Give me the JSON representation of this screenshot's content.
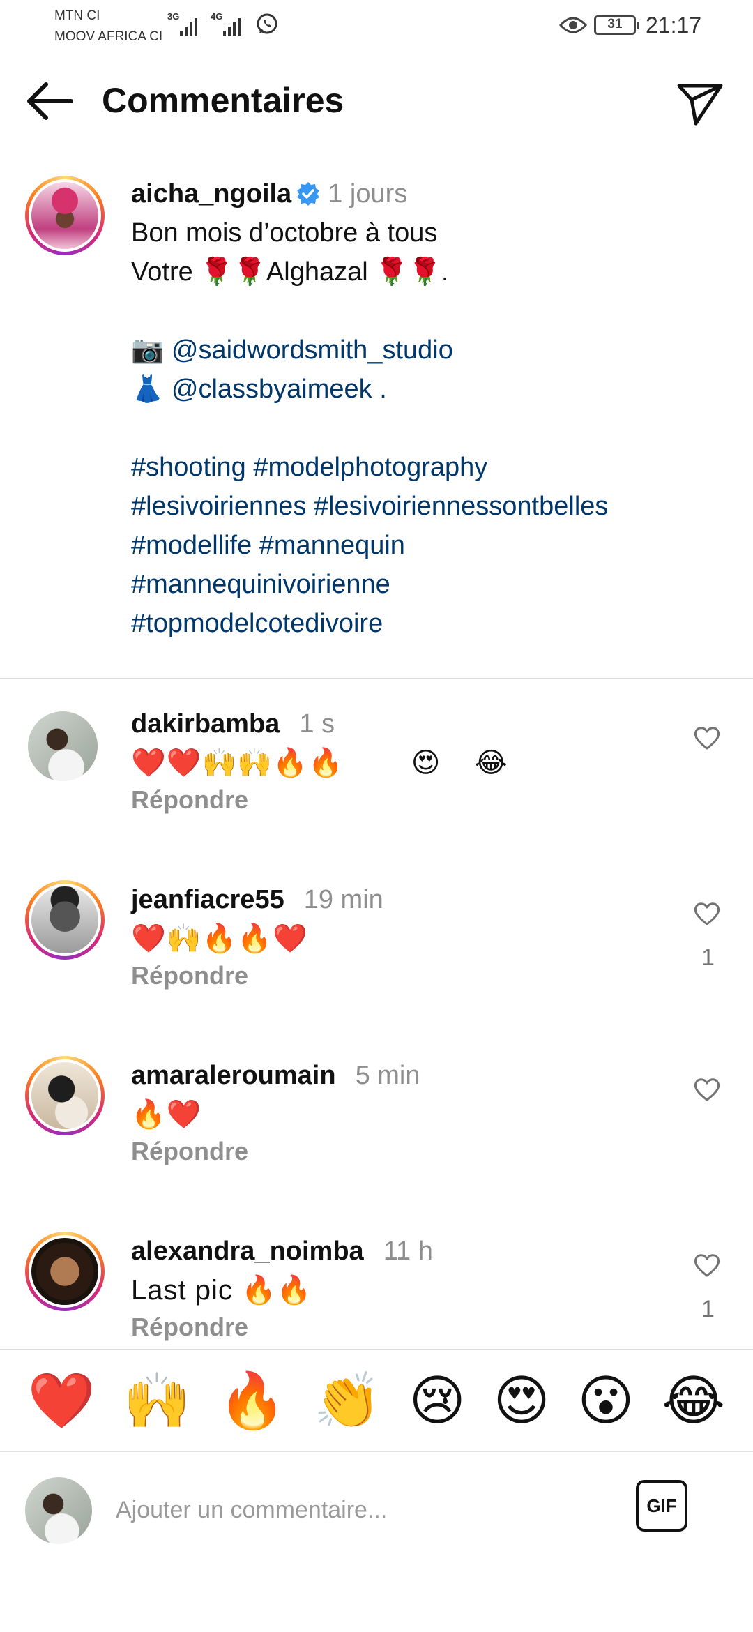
{
  "status_bar": {
    "carrier_1": "MTN CI",
    "carrier_2": "MOOV AFRICA CI",
    "network_1": "3G",
    "network_2": "4G",
    "battery": "31",
    "time": "21:17"
  },
  "header": {
    "title": "Commentaires",
    "back_icon": "arrow-left-icon",
    "send_icon": "paper-plane-icon"
  },
  "caption": {
    "username": "aicha_ngoila",
    "verified": true,
    "time": "1 jours",
    "line_1": "Bon mois d’octobre à tous",
    "line_2": "Votre 🌹🌹Alghazal 🌹🌹.",
    "line_3": "📷 @saidwordsmith_studio",
    "line_4": "👗 @classbyaimeek .",
    "line_5": "#shooting #modelphotography",
    "line_6": "#lesivoiriennes #lesivoiriennessontbelles",
    "line_7": "#modellife #mannequin",
    "line_8": "#mannequinivoirienne",
    "line_9": "#topmodelcotedivoire",
    "mention_1": "@saidwordsmith_studio",
    "mention_2": "@classbyaimeek"
  },
  "comments": [
    {
      "username": "dakirbamba",
      "time": "1 s",
      "text": "❤️❤️🙌🙌🔥🔥        😍    😂",
      "reply_label": "Répondre",
      "likes": ""
    },
    {
      "username": "jeanfiacre55",
      "time": "19 min",
      "text": "❤️🙌🔥🔥❤️",
      "reply_label": "Répondre",
      "likes": "1"
    },
    {
      "username": "amaraleroumain",
      "time": "5 min",
      "text": "🔥❤️",
      "reply_label": "Répondre",
      "likes": ""
    },
    {
      "username": "alexandra_noimba",
      "time": "11 h",
      "text": "Last pic 🔥🔥",
      "reply_label": "Répondre",
      "likes": "1"
    }
  ],
  "quick_reactions": [
    "❤️",
    "🙌",
    "🔥",
    "👏",
    "😢",
    "😍",
    "😮",
    "😂"
  ],
  "composer": {
    "placeholder": "Ajouter un commentaire...",
    "gif_label": "GIF"
  },
  "colors": {
    "link": "#00376b",
    "muted": "#8e8e8e",
    "verified": "#3897f0"
  }
}
